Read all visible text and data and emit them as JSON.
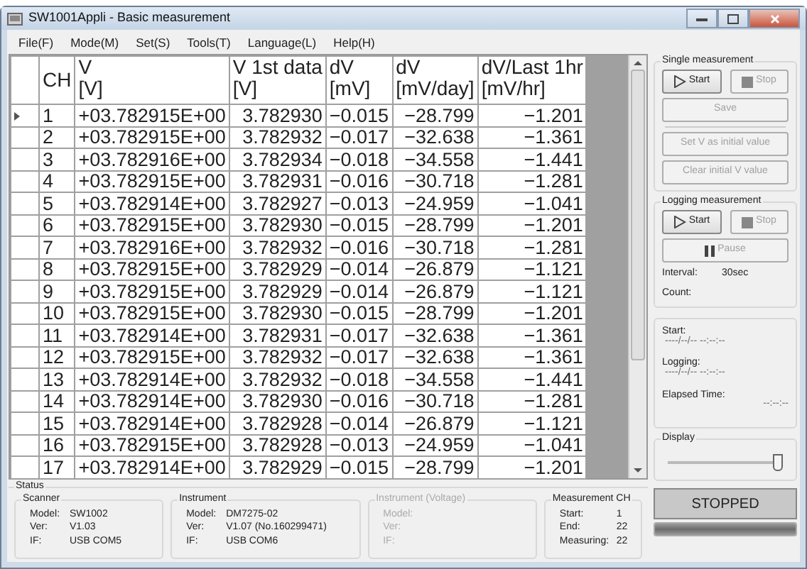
{
  "window": {
    "title": "SW1001Appli - Basic measurement"
  },
  "menu": [
    "File(F)",
    "Mode(M)",
    "Set(S)",
    "Tools(T)",
    "Language(L)",
    "Help(H)"
  ],
  "table": {
    "columns": [
      {
        "label": "CH"
      },
      {
        "label": "V",
        "unit": "[V]"
      },
      {
        "label": "V 1st data",
        "unit": "[V]"
      },
      {
        "label": "dV",
        "unit": "[mV]"
      },
      {
        "label": "dV",
        "unit": "[mV/day]"
      },
      {
        "label": "dV/Last 1hr",
        "unit": "[mV/hr]"
      }
    ],
    "rows": [
      {
        "selected": true,
        "cells": [
          "1",
          "+03.782915E+00",
          "3.782930",
          "−0.015",
          "−28.799",
          "−1.201"
        ]
      },
      {
        "selected": false,
        "cells": [
          "2",
          "+03.782915E+00",
          "3.782932",
          "−0.017",
          "−32.638",
          "−1.361"
        ]
      },
      {
        "selected": false,
        "cells": [
          "3",
          "+03.782916E+00",
          "3.782934",
          "−0.018",
          "−34.558",
          "−1.441"
        ]
      },
      {
        "selected": false,
        "cells": [
          "4",
          "+03.782915E+00",
          "3.782931",
          "−0.016",
          "−30.718",
          "−1.281"
        ]
      },
      {
        "selected": false,
        "cells": [
          "5",
          "+03.782914E+00",
          "3.782927",
          "−0.013",
          "−24.959",
          "−1.041"
        ]
      },
      {
        "selected": false,
        "cells": [
          "6",
          "+03.782915E+00",
          "3.782930",
          "−0.015",
          "−28.799",
          "−1.201"
        ]
      },
      {
        "selected": false,
        "cells": [
          "7",
          "+03.782916E+00",
          "3.782932",
          "−0.016",
          "−30.718",
          "−1.281"
        ]
      },
      {
        "selected": false,
        "cells": [
          "8",
          "+03.782915E+00",
          "3.782929",
          "−0.014",
          "−26.879",
          "−1.121"
        ]
      },
      {
        "selected": false,
        "cells": [
          "9",
          "+03.782915E+00",
          "3.782929",
          "−0.014",
          "−26.879",
          "−1.121"
        ]
      },
      {
        "selected": false,
        "cells": [
          "10",
          "+03.782915E+00",
          "3.782930",
          "−0.015",
          "−28.799",
          "−1.201"
        ]
      },
      {
        "selected": false,
        "cells": [
          "11",
          "+03.782914E+00",
          "3.782931",
          "−0.017",
          "−32.638",
          "−1.361"
        ]
      },
      {
        "selected": false,
        "cells": [
          "12",
          "+03.782915E+00",
          "3.782932",
          "−0.017",
          "−32.638",
          "−1.361"
        ]
      },
      {
        "selected": false,
        "cells": [
          "13",
          "+03.782914E+00",
          "3.782932",
          "−0.018",
          "−34.558",
          "−1.441"
        ]
      },
      {
        "selected": false,
        "cells": [
          "14",
          "+03.782914E+00",
          "3.782930",
          "−0.016",
          "−30.718",
          "−1.281"
        ]
      },
      {
        "selected": false,
        "cells": [
          "15",
          "+03.782914E+00",
          "3.782928",
          "−0.014",
          "−26.879",
          "−1.121"
        ]
      },
      {
        "selected": false,
        "cells": [
          "16",
          "+03.782915E+00",
          "3.782928",
          "−0.013",
          "−24.959",
          "−1.041"
        ]
      },
      {
        "selected": false,
        "cells": [
          "17",
          "+03.782914E+00",
          "3.782929",
          "−0.015",
          "−28.799",
          "−1.201"
        ]
      }
    ]
  },
  "single_measurement": {
    "title": "Single measurement",
    "buttons": [
      {
        "kind": "start",
        "label": "Start",
        "disabled": false
      },
      {
        "kind": "stop",
        "label": "Stop",
        "disabled": true
      },
      {
        "kind": "plain",
        "label": "Save",
        "disabled": true
      },
      {
        "kind": "divider"
      },
      {
        "kind": "plain",
        "label": "Set V as initial value",
        "disabled": true
      },
      {
        "kind": "plain",
        "label": "Clear initial V value",
        "disabled": true
      }
    ]
  },
  "logging_measurement": {
    "title": "Logging measurement",
    "buttons": [
      {
        "kind": "start",
        "label": "Start",
        "disabled": false
      },
      {
        "kind": "stop",
        "label": "Stop",
        "disabled": true
      },
      {
        "kind": "pause",
        "label": "Pause",
        "disabled": true
      }
    ],
    "info": [
      {
        "label": "Interval:",
        "value": "30sec"
      },
      {
        "label": "Count:"
      }
    ]
  },
  "times": [
    {
      "label": "Start:",
      "value": "----/--/-- --:--:--"
    },
    {
      "label": "Logging:",
      "value": "----/--/-- --:--:--"
    },
    {
      "label": "Elapsed Time:",
      "value": "--:--:--"
    }
  ],
  "display": {
    "title": "Display",
    "level": 1.0
  },
  "status": {
    "title": "Status",
    "groups": [
      {
        "title": "Scanner",
        "disabled": false,
        "fields": [
          {
            "label": "Model:",
            "value": "SW1002"
          },
          {
            "label": "Ver:",
            "value": "V1.03"
          },
          {
            "label": "IF:",
            "value": "USB COM5"
          }
        ]
      },
      {
        "title": "Instrument",
        "disabled": false,
        "fields": [
          {
            "label": "Model:",
            "value": "DM7275-02"
          },
          {
            "label": "Ver:",
            "value": "V1.07 (No.160299471)"
          },
          {
            "label": "IF:",
            "value": "USB COM6"
          }
        ]
      },
      {
        "title": "Instrument (Voltage)",
        "disabled": true,
        "fields": [
          {
            "label": "Model:"
          },
          {
            "label": "Ver:"
          },
          {
            "label": "IF:"
          }
        ]
      },
      {
        "title": "Measurement CH",
        "disabled": false,
        "fields": [
          {
            "label": "Start:",
            "value": "1"
          },
          {
            "label": "End:",
            "value": "22"
          },
          {
            "label": "Measuring:",
            "value": "22"
          }
        ]
      }
    ]
  },
  "state_button": {
    "label": "STOPPED"
  },
  "progress": {
    "level": 1.0
  }
}
